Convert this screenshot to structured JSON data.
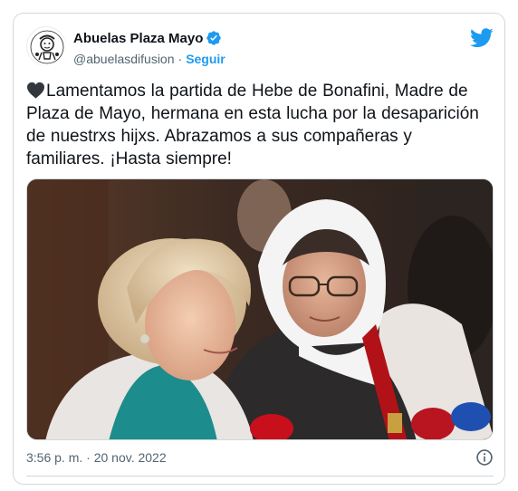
{
  "tweet": {
    "author": {
      "display_name": "Abuelas Plaza Mayo",
      "handle": "@abuelasdifusion",
      "follow_label": "Seguir",
      "separator": "·",
      "verified": true,
      "avatar_icon": "abuelas-logo-icon"
    },
    "text": "Lamentamos la partida de Hebe de Bonafini, Madre de Plaza de Mayo, hermana en esta lucha por la desaparición de nuestrxs hijxs. Abrazamos a sus compañeras y familiares. ¡Hasta siempre!",
    "leading_emoji": "black-heart-icon",
    "timestamp": "3:56 p. m. · 20 nov. 2022",
    "platform_icon": "twitter-bird-icon",
    "info_icon": "info-icon"
  },
  "colors": {
    "accent": "#1d9bf0",
    "text": "#0f1419",
    "secondary": "#536471",
    "border": "#cfd9de"
  }
}
